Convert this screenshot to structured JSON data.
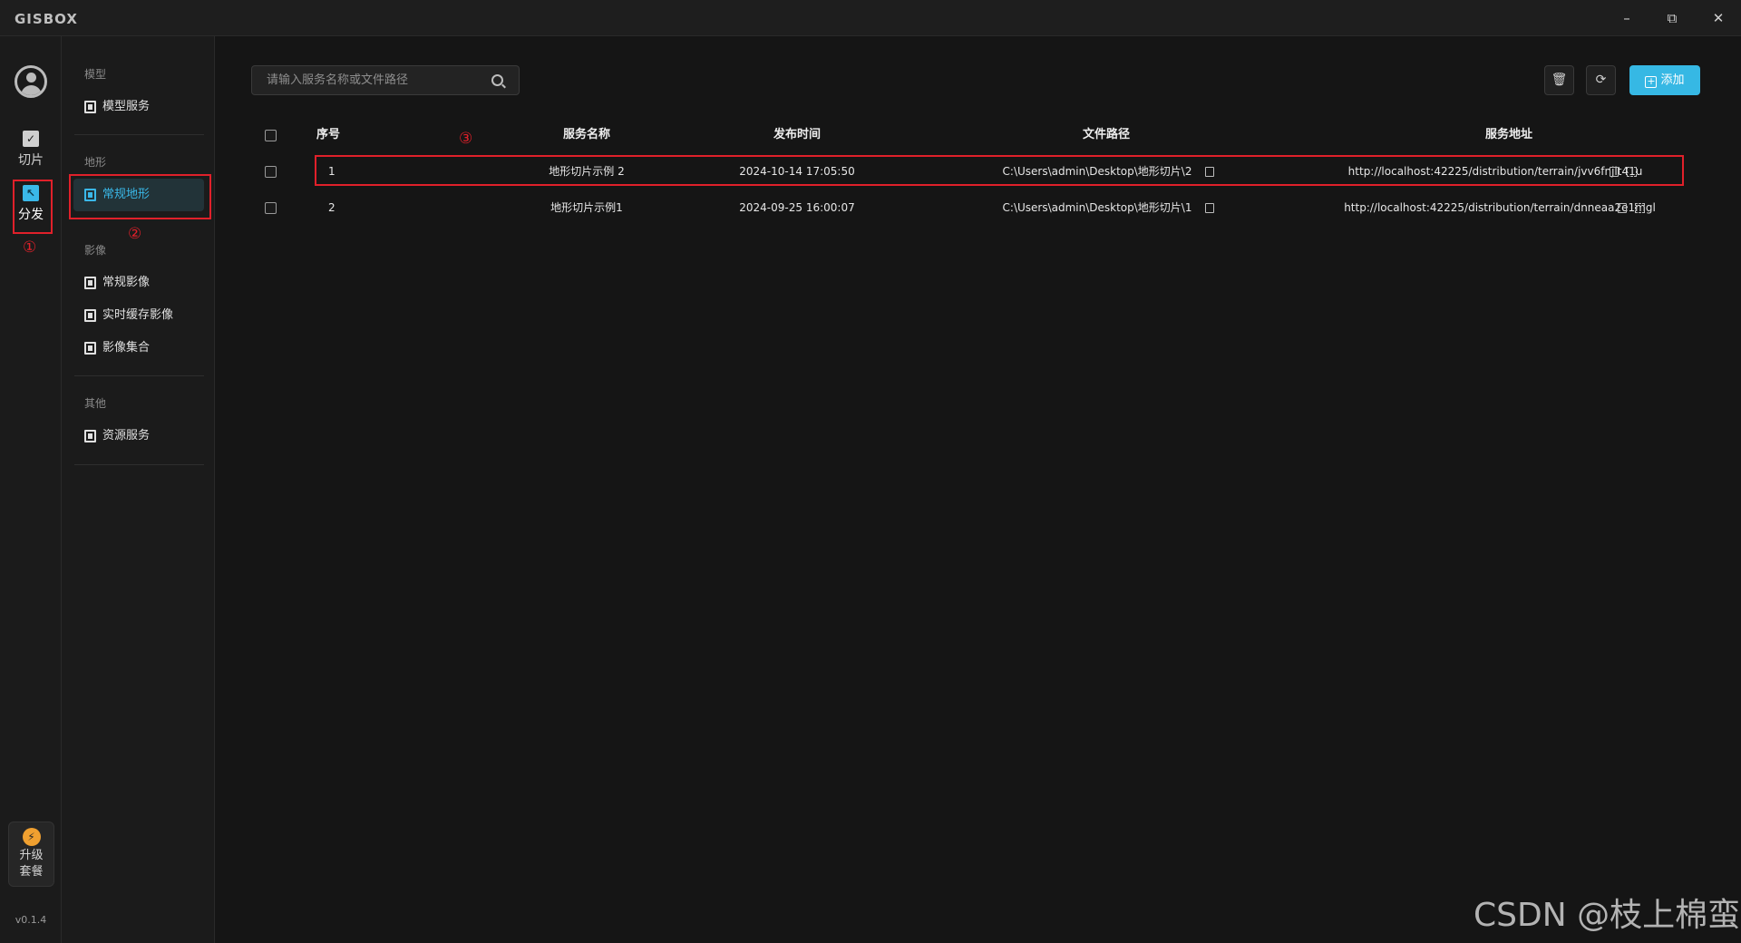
{
  "app": {
    "logo": "GISBOX",
    "version": "v0.1.4",
    "window_controls": {
      "minimize": "–",
      "maximize": "⧉",
      "close": "✕"
    }
  },
  "rail": {
    "items": [
      {
        "label": "切片",
        "icon": "slice-icon"
      },
      {
        "label": "分发",
        "icon": "distribute-icon",
        "active": true
      }
    ],
    "upgrade": {
      "line1": "升级",
      "line2": "套餐"
    }
  },
  "subnav": {
    "groups": [
      {
        "title": "模型",
        "items": [
          {
            "label": "模型服务"
          }
        ]
      },
      {
        "title": "地形",
        "items": [
          {
            "label": "常规地形",
            "active": true
          }
        ]
      },
      {
        "title": "影像",
        "items": [
          {
            "label": "常规影像"
          },
          {
            "label": "实时缓存影像"
          },
          {
            "label": "影像集合"
          }
        ]
      },
      {
        "title": "其他",
        "items": [
          {
            "label": "资源服务"
          }
        ]
      }
    ]
  },
  "toolbar": {
    "search_placeholder": "请输入服务名称或文件路径",
    "add_label": "添加"
  },
  "table": {
    "columns": [
      "序号",
      "服务名称",
      "发布时间",
      "文件路径",
      "服务地址"
    ],
    "rows": [
      {
        "index": "1",
        "name": "地形切片示例 2",
        "time": "2024-10-14 17:05:50",
        "path": "C:\\Users\\admin\\Desktop\\地形切片\\2",
        "url": "http://localhost:42225/distribution/terrain/jvv6fnjlt41u"
      },
      {
        "index": "2",
        "name": "地形切片示例1",
        "time": "2024-09-25 16:00:07",
        "path": "C:\\Users\\admin\\Desktop\\地形切片\\1",
        "url": "http://localhost:42225/distribution/terrain/dnneaa2e1mgl"
      }
    ]
  },
  "annotations": {
    "a1": "①",
    "a2": "②",
    "a3": "③"
  },
  "accent_color": "#36b8e4",
  "highlight_color": "#e0202a",
  "watermark": "CSDN @枝上棉蛮"
}
